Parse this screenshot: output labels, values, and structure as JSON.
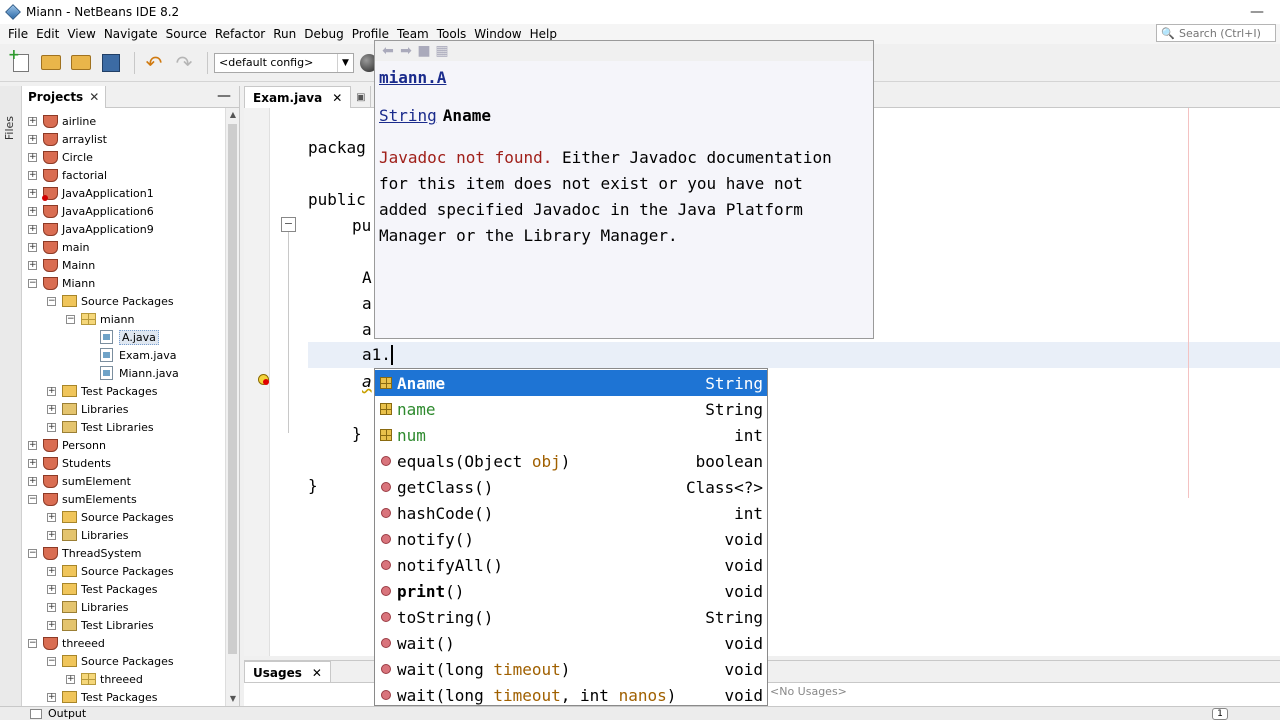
{
  "window": {
    "title": "Miann - NetBeans IDE 8.2",
    "minimize": "—"
  },
  "menu": [
    "File",
    "Edit",
    "View",
    "Navigate",
    "Source",
    "Refactor",
    "Run",
    "Debug",
    "Profile",
    "Team",
    "Tools",
    "Window",
    "Help"
  ],
  "search": {
    "placeholder": "Search (Ctrl+I)"
  },
  "toolbar": {
    "config": "<default config>"
  },
  "left_strip": {
    "files_tab": "Files"
  },
  "projects_panel": {
    "title": "Projects",
    "close": "✕",
    "minimize": "—",
    "tree": [
      {
        "label": "airline",
        "type": "project",
        "depth": 0,
        "exp": "+"
      },
      {
        "label": "arraylist",
        "type": "project",
        "depth": 0,
        "exp": "+"
      },
      {
        "label": "Circle",
        "type": "project",
        "depth": 0,
        "exp": "+"
      },
      {
        "label": "factorial",
        "type": "project",
        "depth": 0,
        "exp": "+"
      },
      {
        "label": "JavaApplication1",
        "type": "project-err",
        "depth": 0,
        "exp": "+"
      },
      {
        "label": "JavaApplication6",
        "type": "project",
        "depth": 0,
        "exp": "+"
      },
      {
        "label": "JavaApplication9",
        "type": "project",
        "depth": 0,
        "exp": "+"
      },
      {
        "label": "main",
        "type": "project",
        "depth": 0,
        "exp": "+"
      },
      {
        "label": "Mainn",
        "type": "project",
        "depth": 0,
        "exp": "+"
      },
      {
        "label": "Miann",
        "type": "project",
        "depth": 0,
        "exp": "−"
      },
      {
        "label": "Source Packages",
        "type": "folder",
        "depth": 1,
        "exp": "−"
      },
      {
        "label": "miann",
        "type": "package",
        "depth": 2,
        "exp": "−"
      },
      {
        "label": "A.java",
        "type": "java",
        "depth": 3,
        "exp": "",
        "selected": true
      },
      {
        "label": "Exam.java",
        "type": "java",
        "depth": 3,
        "exp": ""
      },
      {
        "label": "Miann.java",
        "type": "java",
        "depth": 3,
        "exp": ""
      },
      {
        "label": "Test Packages",
        "type": "folder",
        "depth": 1,
        "exp": "+"
      },
      {
        "label": "Libraries",
        "type": "lib",
        "depth": 1,
        "exp": "+"
      },
      {
        "label": "Test Libraries",
        "type": "lib",
        "depth": 1,
        "exp": "+"
      },
      {
        "label": "Personn",
        "type": "project",
        "depth": 0,
        "exp": "+"
      },
      {
        "label": "Students",
        "type": "project",
        "depth": 0,
        "exp": "+"
      },
      {
        "label": "sumElement",
        "type": "project",
        "depth": 0,
        "exp": "+"
      },
      {
        "label": "sumElements",
        "type": "project",
        "depth": 0,
        "exp": "−"
      },
      {
        "label": "Source Packages",
        "type": "folder",
        "depth": 1,
        "exp": "+"
      },
      {
        "label": "Libraries",
        "type": "lib",
        "depth": 1,
        "exp": "+"
      },
      {
        "label": "ThreadSystem",
        "type": "project",
        "depth": 0,
        "exp": "−"
      },
      {
        "label": "Source Packages",
        "type": "folder",
        "depth": 1,
        "exp": "+"
      },
      {
        "label": "Test Packages",
        "type": "folder",
        "depth": 1,
        "exp": "+"
      },
      {
        "label": "Libraries",
        "type": "lib",
        "depth": 1,
        "exp": "+"
      },
      {
        "label": "Test Libraries",
        "type": "lib",
        "depth": 1,
        "exp": "+"
      },
      {
        "label": "threeed",
        "type": "project",
        "depth": 0,
        "exp": "−"
      },
      {
        "label": "Source Packages",
        "type": "folder",
        "depth": 1,
        "exp": "−"
      },
      {
        "label": "threeed",
        "type": "package",
        "depth": 2,
        "exp": "+"
      },
      {
        "label": "Test Packages",
        "type": "folder",
        "depth": 1,
        "exp": "+"
      }
    ]
  },
  "editor": {
    "tab": "Exam.java",
    "tab_close": "✕",
    "code": {
      "package_kw": "packag",
      "public_kw": "public",
      "pu": "pu",
      "a_line1": "A",
      "a_line2": "a",
      "a_line3": "a",
      "current": "a1.",
      "a_line5": "a",
      "brace1": "}",
      "brace2": "}"
    }
  },
  "javadoc": {
    "class_name": "miann.A",
    "field_type": "String",
    "field_name": "Aname",
    "not_found": "Javadoc not found.",
    "message": " Either Javadoc documentation for this item does not exist or you have not added specified Javadoc in the Java Platform Manager or the Library Manager."
  },
  "completion": [
    {
      "parts": [
        {
          "t": "Aname"
        }
      ],
      "type": "String",
      "icon": "field",
      "selected": true
    },
    {
      "parts": [
        {
          "t": "name"
        }
      ],
      "type": "String",
      "icon": "field",
      "green": true
    },
    {
      "parts": [
        {
          "t": "num"
        }
      ],
      "type": "int",
      "icon": "field",
      "green": true
    },
    {
      "parts": [
        {
          "t": "equals(Object "
        },
        {
          "t": "obj",
          "p": true
        },
        {
          "t": ")"
        }
      ],
      "type": "boolean",
      "icon": "method"
    },
    {
      "parts": [
        {
          "t": "getClass()"
        }
      ],
      "type": "Class<?>",
      "icon": "method"
    },
    {
      "parts": [
        {
          "t": "hashCode()"
        }
      ],
      "type": "int",
      "icon": "method"
    },
    {
      "parts": [
        {
          "t": "notify()"
        }
      ],
      "type": "void",
      "icon": "method"
    },
    {
      "parts": [
        {
          "t": "notifyAll()"
        }
      ],
      "type": "void",
      "icon": "method"
    },
    {
      "parts": [
        {
          "t": "print",
          "b": true
        },
        {
          "t": "()"
        }
      ],
      "type": "void",
      "icon": "method"
    },
    {
      "parts": [
        {
          "t": "toString()"
        }
      ],
      "type": "String",
      "icon": "method"
    },
    {
      "parts": [
        {
          "t": "wait()"
        }
      ],
      "type": "void",
      "icon": "method"
    },
    {
      "parts": [
        {
          "t": "wait(long "
        },
        {
          "t": "timeout",
          "p": true
        },
        {
          "t": ")"
        }
      ],
      "type": "void",
      "icon": "method"
    },
    {
      "parts": [
        {
          "t": "wait(long "
        },
        {
          "t": "timeout",
          "p": true
        },
        {
          "t": ", int "
        },
        {
          "t": "nanos",
          "p": true
        },
        {
          "t": ")"
        }
      ],
      "type": "void",
      "icon": "method"
    }
  ],
  "usages": {
    "tab": "Usages",
    "close": "✕",
    "empty": "<No Usages>"
  },
  "status": {
    "output": "Output",
    "count": "1"
  }
}
